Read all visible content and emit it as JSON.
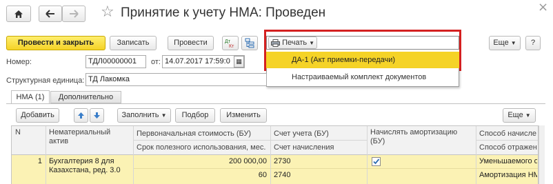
{
  "header": {
    "title": "Принятие к учету НМА: Проведен",
    "star": "☆",
    "close": "×"
  },
  "toolbar": {
    "post_close": "Провести и закрыть",
    "save": "Записать",
    "post": "Провести",
    "dt_kt": "Дт Кт",
    "print": "Печать",
    "more": "Еще",
    "help": "?"
  },
  "print_menu": {
    "items": [
      "ДА-1 (Акт приемки-передачи)",
      "Настраиваемый комплект документов"
    ]
  },
  "form": {
    "number_label": "Номер:",
    "number_value": "ТДЛ00000001",
    "date_label": "от:",
    "date_value": "14.07.2017 17:59:0",
    "unit_label": "Структурная единица:",
    "unit_value": "ТД Лакомка"
  },
  "tabs": [
    "НМА (1)",
    "Дополнительно"
  ],
  "table_toolbar": {
    "add": "Добавить",
    "fill": "Заполнить",
    "pick": "Подбор",
    "change": "Изменить",
    "more": "Еще"
  },
  "table": {
    "headers": {
      "n": "N",
      "asset": "Нематериальный актив",
      "cost_top": "Первоначальная стоимость (БУ)",
      "cost_bottom": "Срок полезного использования, мес.",
      "account_top": "Счет учета (БУ)",
      "account_bottom": "Счет начисления",
      "amort": "Начислять амортизацию (БУ)",
      "method_top": "Способ начисле",
      "method_bottom": "Способ отражен"
    },
    "rows": [
      {
        "n": "1",
        "asset_line1": "Бухгалтерия 8 для",
        "asset_line2": "Казахстана, ред. 3.0",
        "cost": "200 000,00",
        "life": "60",
        "account": "2730",
        "account2": "2740",
        "amort_checked": true,
        "method": "Уменьшаемого о",
        "reflect": "Амортизация НМ"
      }
    ]
  },
  "colors": {
    "accent_yellow": "#f5d327",
    "highlight_red": "#d42020",
    "selected_row": "#fbf2b4"
  }
}
